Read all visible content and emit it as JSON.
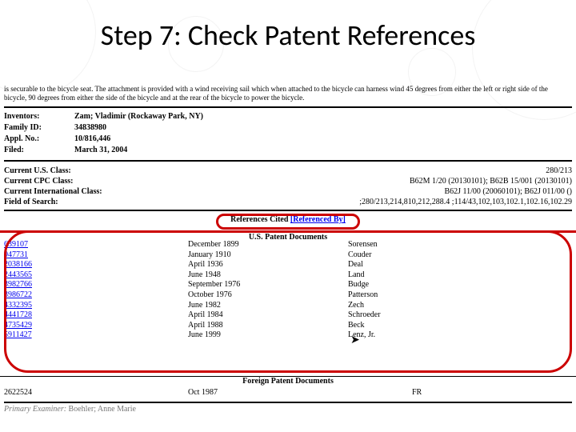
{
  "title": "Step 7: Check Patent References",
  "description": "is securable to the bicycle seat. The attachment is provided with a wind receiving sail which when attached to the bicycle can harness wind 45 degrees from either the left or right side of the bicycle, 90 degrees from either the side of the bicycle and at the rear of the bicycle to power the bicycle.",
  "meta": {
    "inventors": {
      "label": "Inventors:",
      "value": "Zam; Vladimir (Rockaway Park, NY)"
    },
    "family": {
      "label": "Family ID:",
      "value": "34838980"
    },
    "appl": {
      "label": "Appl. No.:",
      "value": "10/816,446"
    },
    "filed": {
      "label": "Filed:",
      "value": "March 31, 2004"
    }
  },
  "classes": {
    "us": {
      "label": "Current U.S. Class:",
      "value": "280/213"
    },
    "cpc": {
      "label": "Current CPC Class:",
      "value": "B62M 1/20 (20130101); B62B 15/001 (20130101)"
    },
    "intl": {
      "label": "Current International Class:",
      "value": "B62J 11/00 (20060101); B62J 011/00 ()"
    },
    "fos": {
      "label": "Field of Search:",
      "value": ";280/213,214,810,212,288.4 ;114/43,102,103,102.1,102.16,102.29"
    }
  },
  "refs": {
    "cited_label": "References Cited ",
    "refby_link": "[Referenced By]"
  },
  "subheaders": {
    "us": "U.S. Patent Documents",
    "foreign": "Foreign Patent Documents"
  },
  "patents": [
    {
      "num": "639107",
      "date": "December 1899",
      "who": "Sorensen"
    },
    {
      "num": "947731",
      "date": "January 1910",
      "who": "Couder"
    },
    {
      "num": "2038166",
      "date": "April 1936",
      "who": "Deal"
    },
    {
      "num": "2443565",
      "date": "June 1948",
      "who": "Land"
    },
    {
      "num": "3982766",
      "date": "September 1976",
      "who": "Budge"
    },
    {
      "num": "3986722",
      "date": "October 1976",
      "who": "Patterson"
    },
    {
      "num": "4332395",
      "date": "June 1982",
      "who": "Zech"
    },
    {
      "num": "4441728",
      "date": "April 1984",
      "who": "Schroeder"
    },
    {
      "num": "4735429",
      "date": "April 1988",
      "who": "Beck"
    },
    {
      "num": "5911427",
      "date": "June 1999",
      "who": "Lenz, Jr."
    }
  ],
  "foreign": [
    {
      "num": "2622524",
      "date": "Oct 1987",
      "who": "FR"
    }
  ],
  "examiner": {
    "label": "Primary Examiner:",
    "value": " Boehler; Anne Marie"
  }
}
